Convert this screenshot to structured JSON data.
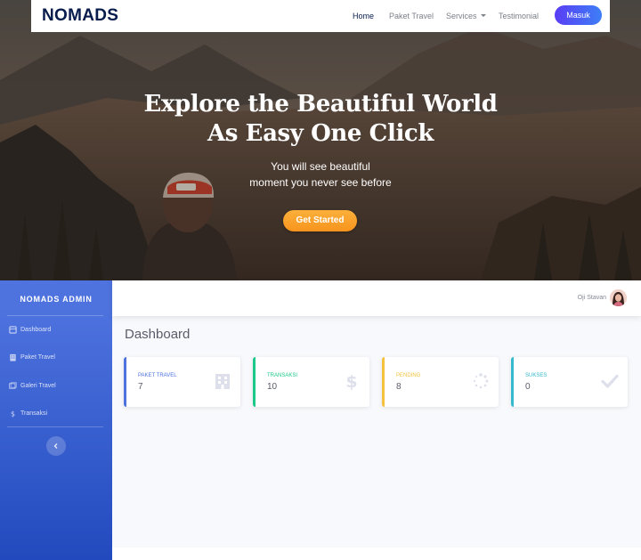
{
  "site": {
    "logo": "NOMADS",
    "nav": [
      {
        "label": "Home"
      },
      {
        "label": "Paket Travel"
      },
      {
        "label": "Services"
      },
      {
        "label": "Testimonial"
      }
    ],
    "login_label": "Masuk"
  },
  "hero": {
    "title_line1": "Explore the Beautiful World",
    "title_line2": "As Easy One Click",
    "subtitle_line1": "You will see beautiful",
    "subtitle_line2": "moment you never see before",
    "cta_label": "Get Started"
  },
  "admin": {
    "brand": "NOMADS ADMIN",
    "menu": [
      {
        "label": "Dashboard",
        "icon": "dashboard-icon"
      },
      {
        "label": "Paket Travel",
        "icon": "building-icon"
      },
      {
        "label": "Galeri Travel",
        "icon": "images-icon"
      },
      {
        "label": "Transaksi",
        "icon": "dollar-icon"
      }
    ],
    "user_name": "Oji Stavan",
    "page_title": "Dashboard",
    "cards": [
      {
        "label": "PAKET TRAVEL",
        "value": "7",
        "color": "#4e73df",
        "icon": "building-icon"
      },
      {
        "label": "TRANSAKSI",
        "value": "10",
        "color": "#1cc88a",
        "icon": "dollar-icon"
      },
      {
        "label": "PENDING",
        "value": "8",
        "color": "#f6c23e",
        "icon": "spinner-icon"
      },
      {
        "label": "SUKSES",
        "value": "0",
        "color": "#36b9cc",
        "icon": "check-icon"
      }
    ]
  },
  "colors": {
    "navy": "#071c4d",
    "sidebar_top": "#4e73df",
    "sidebar_bottom": "#224abe",
    "cta_orange": "#f7941d",
    "login_gradient_start": "#5a3df5",
    "login_gradient_end": "#3d7ff7"
  }
}
